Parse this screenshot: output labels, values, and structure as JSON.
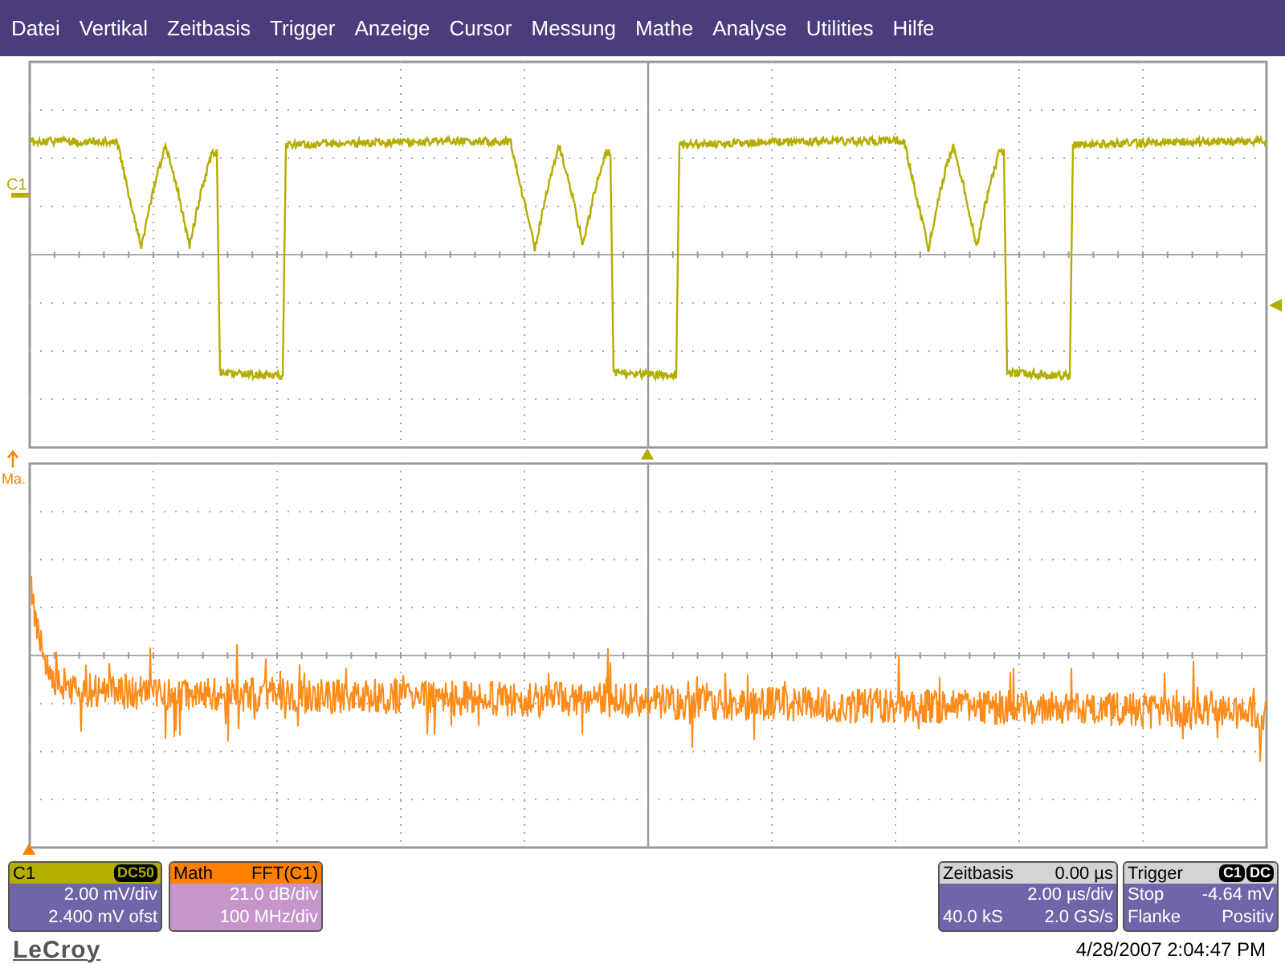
{
  "menu": [
    "Datei",
    "Vertikal",
    "Zeitbasis",
    "Trigger",
    "Anzeige",
    "Cursor",
    "Messung",
    "Mathe",
    "Analyse",
    "Utilities",
    "Hilfe"
  ],
  "traces": {
    "channel_label": "C1",
    "math_label": "Ma."
  },
  "channel_panel": {
    "name": "C1",
    "coupling": "DC50",
    "scale": "2.00 mV/div",
    "offset": "2.400 mV ofst"
  },
  "math_panel": {
    "name": "Math",
    "function": "FFT(C1)",
    "scale": "21.0 dB/div",
    "span": "100 MHz/div"
  },
  "timebase_panel": {
    "title": "Zeitbasis",
    "delay": "0.00 µs",
    "scale": "2.00 µs/div",
    "samples": "40.0 kS",
    "rate": "2.0 GS/s"
  },
  "trigger_panel": {
    "title": "Trigger",
    "source": "C1",
    "coupling": "DC",
    "mode": "Stop",
    "level": "-4.64 mV",
    "slope_label": "Flanke",
    "slope": "Positiv"
  },
  "logo": "LeCroy",
  "timestamp": "4/28/2007 2:04:47 PM"
}
